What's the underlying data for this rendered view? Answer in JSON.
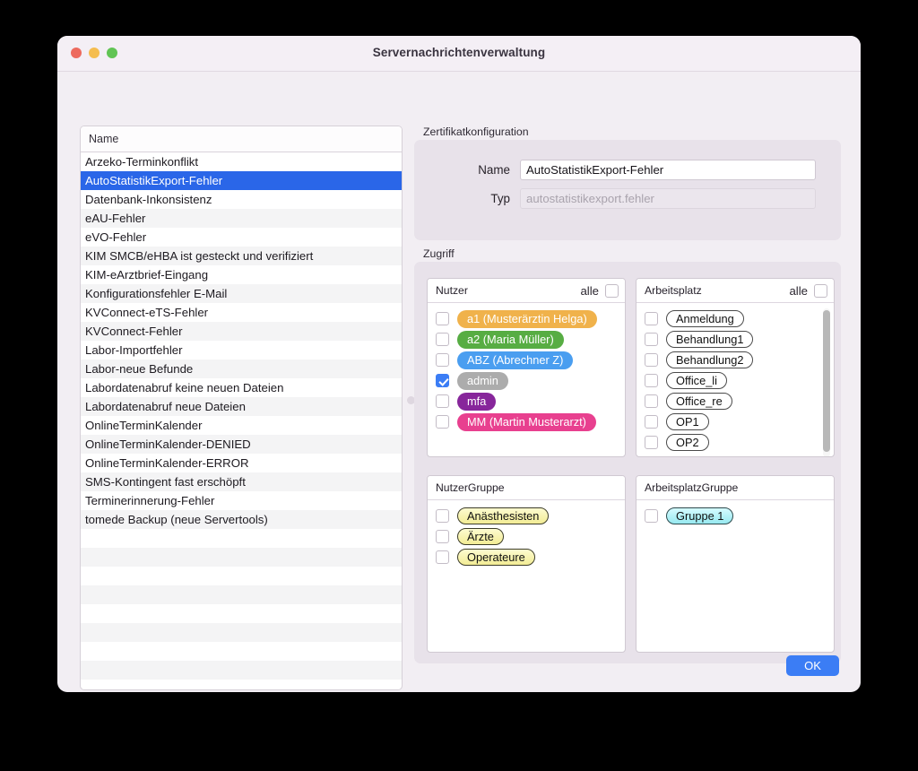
{
  "window": {
    "title": "Servernachrichtenverwaltung",
    "traffic_lights": [
      {
        "name": "close-button",
        "color": "#ed6a5e"
      },
      {
        "name": "minimize-button",
        "color": "#f5bd4f"
      },
      {
        "name": "maximize-button",
        "color": "#61c454"
      }
    ]
  },
  "list": {
    "column_header": "Name",
    "selected_index": 1,
    "items": [
      "Arzeko-Terminkonflikt",
      "AutoStatistikExport-Fehler",
      "Datenbank-Inkonsistenz",
      "eAU-Fehler",
      "eVO-Fehler",
      "KIM SMCB/eHBA ist gesteckt und verifiziert",
      "KIM-eArztbrief-Eingang",
      "Konfigurationsfehler E-Mail",
      "KVConnect-eTS-Fehler",
      "KVConnect-Fehler",
      "Labor-Importfehler",
      "Labor-neue Befunde",
      "Labordatenabruf keine neuen Dateien",
      "Labordatenabruf neue Dateien",
      "OnlineTerminKalender",
      "OnlineTerminKalender-DENIED",
      "OnlineTerminKalender-ERROR",
      "SMS-Kontingent fast erschöpft",
      "Terminerinnerung-Fehler",
      "tomede Backup (neue Servertools)",
      "",
      "",
      "",
      "",
      "",
      "",
      "",
      ""
    ]
  },
  "certificate": {
    "group_label": "Zertifikatkonfiguration",
    "name_label": "Name",
    "name_value": "AutoStatistikExport-Fehler",
    "typ_label": "Typ",
    "typ_value": "autostatistikexport.fehler",
    "typ_disabled": true
  },
  "access": {
    "group_label": "Zugriff",
    "alle_label": "alle",
    "panels": [
      {
        "key": "nutzer",
        "title": "Nutzer",
        "has_alle": true,
        "alle_checked": false,
        "has_scrollbar": false,
        "tag_style": "solid",
        "items": [
          {
            "label": "a1 (Musterärztin Helga)",
            "checked": false,
            "color": "#f0b24b"
          },
          {
            "label": "a2 (Maria Müller)",
            "checked": false,
            "color": "#57ad43"
          },
          {
            "label": "ABZ (Abrechner Z)",
            "checked": false,
            "color": "#4a9ef0"
          },
          {
            "label": "admin",
            "checked": true,
            "color": "#acacac"
          },
          {
            "label": "mfa",
            "checked": false,
            "color": "#87269b"
          },
          {
            "label": "MM (Martin Musterarzt)",
            "checked": false,
            "color": "#e8408f"
          }
        ]
      },
      {
        "key": "arbeitsplatz",
        "title": "Arbeitsplatz",
        "has_alle": true,
        "alle_checked": false,
        "has_scrollbar": true,
        "tag_style": "outline",
        "items": [
          {
            "label": "Anmeldung",
            "checked": false
          },
          {
            "label": "Behandlung1",
            "checked": false
          },
          {
            "label": "Behandlung2",
            "checked": false
          },
          {
            "label": "Office_li",
            "checked": false
          },
          {
            "label": "Office_re",
            "checked": false
          },
          {
            "label": "OP1",
            "checked": false
          },
          {
            "label": "OP2",
            "checked": false
          }
        ]
      },
      {
        "key": "nutzergruppe",
        "title": "NutzerGruppe",
        "has_alle": false,
        "has_scrollbar": false,
        "tag_style": "yellow",
        "items": [
          {
            "label": "Anästhesisten",
            "checked": false
          },
          {
            "label": "Ärzte",
            "checked": false
          },
          {
            "label": "Operateure",
            "checked": false
          }
        ]
      },
      {
        "key": "arbeitsplatzgruppe",
        "title": "ArbeitsplatzGruppe",
        "has_alle": false,
        "has_scrollbar": false,
        "tag_style": "cyan",
        "items": [
          {
            "label": "Gruppe 1",
            "checked": false
          }
        ]
      }
    ]
  },
  "footer": {
    "ok_label": "OK",
    "ok_color": "#3b7df5"
  }
}
